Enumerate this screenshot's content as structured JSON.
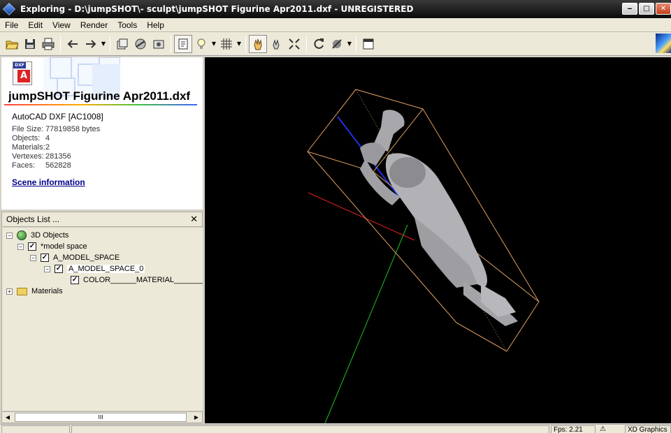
{
  "window": {
    "title": "Exploring - D:\\jumpSHOT\\- sculpt\\jumpSHOT Figurine Apr2011.dxf - UNREGISTERED",
    "buttons": {
      "minimize": "‒",
      "maximize": "□",
      "close": "✕"
    }
  },
  "menu": [
    {
      "label": "File"
    },
    {
      "label": "Edit"
    },
    {
      "label": "View"
    },
    {
      "label": "Render"
    },
    {
      "label": "Tools"
    },
    {
      "label": "Help"
    }
  ],
  "info": {
    "icon_tag": "DXF",
    "icon_glyph": "A",
    "file_title": "jumpSHOT Figurine Apr2011.dxf",
    "format": "AutoCAD DXF [AC1008]",
    "properties": [
      {
        "label": "File Size:",
        "value": "77819858 bytes"
      },
      {
        "label": "Objects:",
        "value": "4"
      },
      {
        "label": "Materials:",
        "value": "2"
      },
      {
        "label": "Vertexes:",
        "value": "281356"
      },
      {
        "label": "Faces:",
        "value": "562828"
      }
    ],
    "scene_link": "Scene information"
  },
  "objects_list": {
    "header": "Objects List  ...",
    "close": "✕",
    "nodes": [
      {
        "label": "3D Objects",
        "expander": "−"
      },
      {
        "label": "*model space",
        "expander": "−",
        "checked": "✓"
      },
      {
        "label": "A_MODEL_SPACE",
        "expander": "−",
        "checked": "✓"
      },
      {
        "label": "A_MODEL_SPACE_0",
        "expander": "−",
        "checked": "✓"
      },
      {
        "label": "COLOR______MATERIAL_________",
        "checked": "✓"
      },
      {
        "label": "Materials",
        "expander": "+"
      }
    ],
    "scroll_thumb": "III"
  },
  "status": {
    "fps": "Fps: 2.21",
    "renderer": "XD Graphics"
  },
  "colors": {
    "viewport_bg": "#000000",
    "bbox": "#e0a060",
    "axis_x": "#e02020",
    "axis_y": "#20c020",
    "axis_z": "#2030e0",
    "model": "#a8a8ac"
  }
}
